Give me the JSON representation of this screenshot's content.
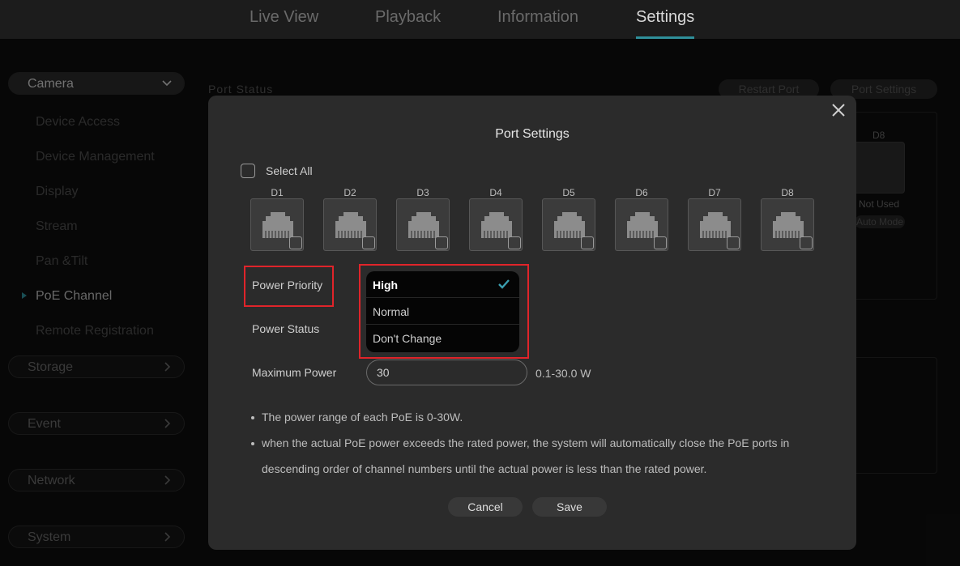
{
  "nav": {
    "tabs": [
      {
        "label": "Live View"
      },
      {
        "label": "Playback"
      },
      {
        "label": "Information"
      },
      {
        "label": "Settings"
      }
    ],
    "active_tab": "Settings",
    "accent_color": "#2f8f9a"
  },
  "sidebar": {
    "groups": [
      {
        "label": "Camera",
        "expanded": true
      },
      {
        "label": "Storage"
      },
      {
        "label": "Event"
      },
      {
        "label": "Network"
      },
      {
        "label": "System"
      }
    ],
    "camera_items": [
      {
        "label": "Device Access"
      },
      {
        "label": "Device Management"
      },
      {
        "label": "Display"
      },
      {
        "label": "Stream"
      },
      {
        "label": "Pan &Tilt"
      },
      {
        "label": "PoE Channel"
      },
      {
        "label": "Remote Registration"
      }
    ],
    "active_item": "PoE Channel"
  },
  "background": {
    "section_title": "Port Status",
    "restart_port_label": "Restart Port",
    "port_settings_label": "Port Settings",
    "d8_label": "D8",
    "d8_status": "Not Used",
    "d8_mode": "Auto Mode"
  },
  "modal": {
    "title": "Port Settings",
    "select_all_label": "Select All",
    "ports": [
      {
        "label": "D1"
      },
      {
        "label": "D2"
      },
      {
        "label": "D3"
      },
      {
        "label": "D4"
      },
      {
        "label": "D5"
      },
      {
        "label": "D6"
      },
      {
        "label": "D7"
      },
      {
        "label": "D8"
      }
    ],
    "power_priority_label": "Power Priority",
    "power_status_label": "Power Status",
    "maximum_power_label": "Maximum Power",
    "priority_options": [
      {
        "label": "High",
        "selected": true
      },
      {
        "label": "Normal"
      },
      {
        "label": "Don't Change"
      }
    ],
    "maximum_power_value": "30",
    "maximum_power_range": "0.1-30.0 W",
    "notes": [
      "The power range of each PoE is 0-30W.",
      "when the actual PoE power exceeds the rated power, the system will automatically close the PoE ports in",
      "descending order of channel numbers until the actual power is less than the rated power."
    ],
    "cancel_label": "Cancel",
    "save_label": "Save",
    "highlight_color": "#e0242a"
  }
}
